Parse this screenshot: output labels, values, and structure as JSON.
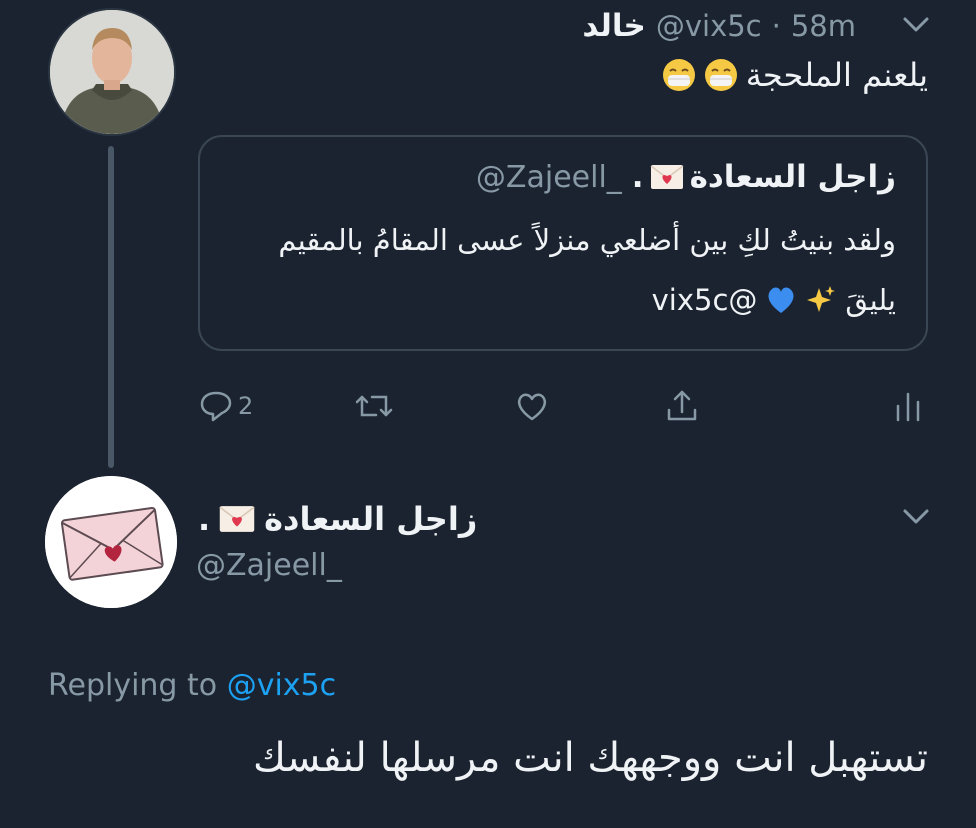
{
  "top_tweet": {
    "display_name": "خالد",
    "handle": "@vix5c",
    "separator": "·",
    "time": "58m",
    "text": "يلعنم الملحجة",
    "emoji": "mask-face-emoji x2"
  },
  "quoted_tweet": {
    "display_name": "زاجل السعادة",
    "display_name_suffix": ".",
    "handle": "@Zajeell_",
    "line1": "ولقد بنيتُ لكِ بين أضلعي منزلاً عسى المقامُ بالمقيم",
    "line2_text": "يليقَ",
    "line2_mention": "@vix5c",
    "emojis": [
      "sparkles-emoji",
      "blue-heart-emoji"
    ]
  },
  "actions": {
    "reply_count": "2",
    "icons": [
      "reply-icon",
      "retweet-icon",
      "like-icon",
      "share-icon",
      "analytics-icon"
    ]
  },
  "main_tweet": {
    "display_name": "زاجل السعادة",
    "display_name_suffix": ".",
    "handle": "@Zajeell_",
    "replying_label": "Replying to",
    "replying_handle": "@vix5c",
    "text": "تستهبل انت ووجههك انت مرسلها لنفسك"
  },
  "colors": {
    "background": "#1b2330",
    "text": "#f0f3f5",
    "muted": "#8899a6",
    "link": "#1da1f2"
  }
}
